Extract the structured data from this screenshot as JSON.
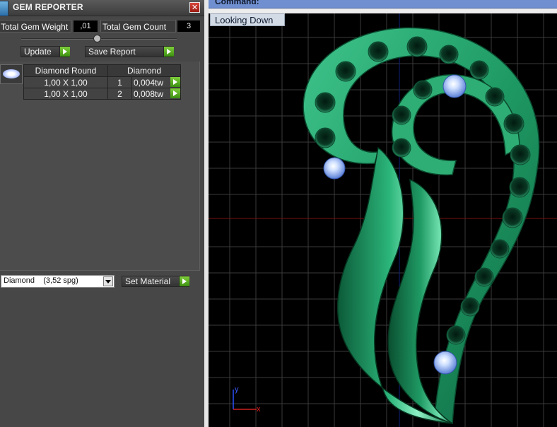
{
  "panel": {
    "title": "GEM REPORTER",
    "close_label": "✕",
    "total_gem_weight_label": "Total Gem Weight",
    "total_gem_weight_value": ",01",
    "total_gem_count_label": "Total Gem Count",
    "total_gem_count_value": "3",
    "update_label": "Update",
    "save_report_label": "Save Report",
    "gem_table": {
      "headers": [
        "Diamond Round",
        "Diamond"
      ],
      "rows": [
        {
          "size": "1,00 X 1,00",
          "count": "1",
          "weight": "0,004tw"
        },
        {
          "size": "1,00 X 1,00",
          "count": "2",
          "weight": "0,008tw"
        }
      ]
    },
    "material_value": "Diamond    (3,52 spg)",
    "set_material_label": "Set Material"
  },
  "viewport": {
    "command_label": "Command:",
    "view_label": "Looking Down",
    "axis_y": "y",
    "axis_x": "x"
  },
  "icons": {
    "app": "gem-app-icon",
    "close": "close-icon",
    "play": "green-play-arrow-icon",
    "dropdown": "chevron-down-icon",
    "gem": "round-diamond-icon"
  },
  "colors": {
    "panel_bg": "#474747",
    "accent_green": "#5cb51f",
    "command_bar": "#6f8fd0",
    "model_green": "#1f8a5c",
    "grid": "#3a3a3a"
  }
}
